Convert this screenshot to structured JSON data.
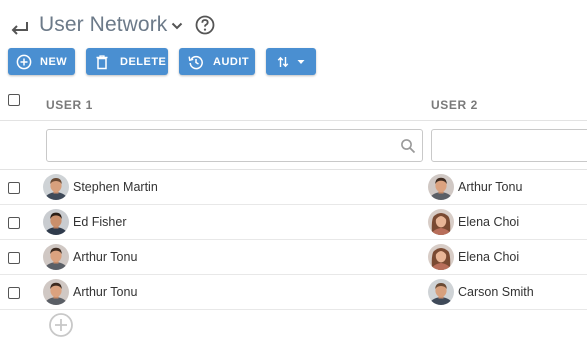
{
  "header": {
    "title": "User Network"
  },
  "toolbar": {
    "new_label": "NEW",
    "delete_label": "DELETE",
    "audit_label": "AUDIT"
  },
  "grid": {
    "columns": [
      "USER 1",
      "USER 2"
    ],
    "rows": [
      {
        "user1": "Stephen Martin",
        "user2": "Arthur Tonu"
      },
      {
        "user1": "Ed Fisher",
        "user2": "Elena Choi"
      },
      {
        "user1": "Arthur Tonu",
        "user2": "Elena Choi"
      },
      {
        "user1": "Arthur Tonu",
        "user2": "Carson Smith"
      }
    ]
  },
  "colors": {
    "accent": "#4a8fd1",
    "title": "#6c7a89"
  }
}
